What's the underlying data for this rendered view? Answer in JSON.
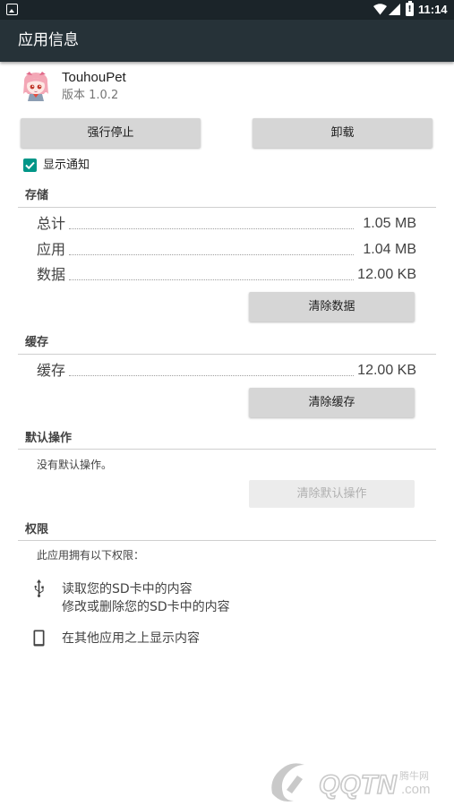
{
  "status_bar": {
    "time": "11:14",
    "icons": [
      "notification-icon",
      "wifi-icon",
      "signal-icon",
      "battery-alert-icon"
    ]
  },
  "app_bar": {
    "title": "应用信息"
  },
  "app": {
    "name": "TouhouPet",
    "version": "版本 1.0.2",
    "icon": "app-icon"
  },
  "buttons": {
    "force_stop": "强行停止",
    "uninstall": "卸载"
  },
  "show_notifications": {
    "label": "显示通知",
    "checked": true,
    "color": "#009688"
  },
  "storage": {
    "header": "存储",
    "rows": [
      {
        "label": "总计",
        "value": "1.05 MB"
      },
      {
        "label": "应用",
        "value": "1.04 MB"
      },
      {
        "label": "数据",
        "value": "12.00 KB"
      }
    ],
    "clear_button": "清除数据"
  },
  "cache": {
    "header": "缓存",
    "rows": [
      {
        "label": "缓存",
        "value": "12.00 KB"
      }
    ],
    "clear_button": "清除缓存"
  },
  "defaults": {
    "header": "默认操作",
    "message": "没有默认操作。",
    "clear_button": "清除默认操作"
  },
  "permissions": {
    "header": "权限",
    "intro": "此应用拥有以下权限：",
    "items": [
      {
        "icon": "usb-icon",
        "lines": [
          "读取您的SD卡中的内容",
          "修改或删除您的SD卡中的内容"
        ]
      },
      {
        "icon": "phone-icon",
        "lines": [
          "在其他应用之上显示内容"
        ]
      }
    ]
  },
  "watermark": {
    "text_small": "腾牛网",
    "text_large": "QQTN.com"
  },
  "colors": {
    "app_bar": "#263238",
    "status_bar": "#1b2429",
    "accent": "#009688",
    "button": "#d6d6d6"
  }
}
